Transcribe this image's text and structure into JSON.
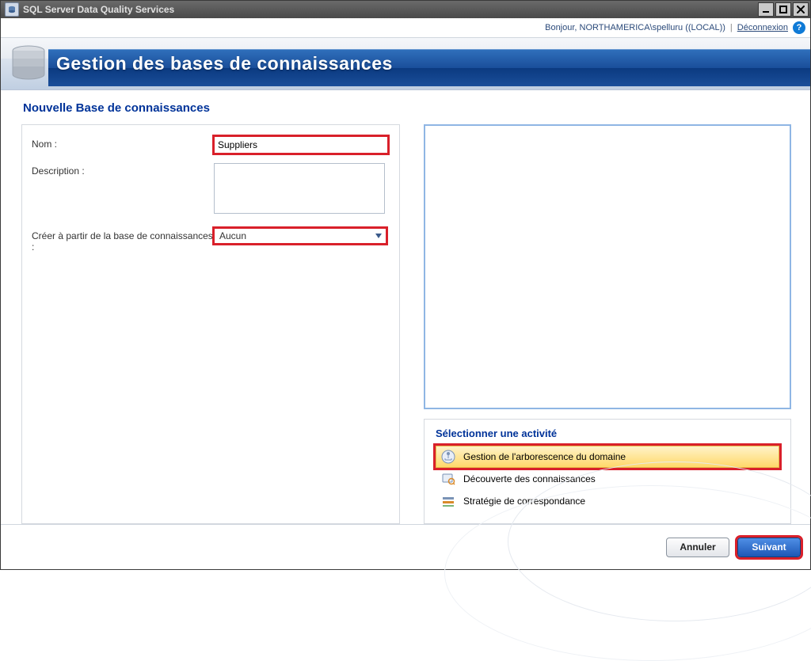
{
  "window": {
    "title": "SQL Server Data Quality Services"
  },
  "greetbar": {
    "greeting": "Bonjour, NORTHAMERICA\\spelluru ((LOCAL))",
    "separator": "|",
    "logout": "Déconnexion",
    "help_glyph": "?"
  },
  "banner": {
    "title": "Gestion des bases de connaissances"
  },
  "section": {
    "title": "Nouvelle Base de connaissances"
  },
  "form": {
    "name_label": "Nom :",
    "name_value": "Suppliers",
    "desc_label": "Description :",
    "desc_value": "",
    "createfrom_label": "Créer à partir de la base de connaissances :",
    "createfrom_value": "Aucun"
  },
  "activity": {
    "title": "Sélectionner une activité",
    "items": [
      {
        "label": "Gestion de l'arborescence du domaine",
        "selected": true
      },
      {
        "label": "Découverte des connaissances",
        "selected": false
      },
      {
        "label": "Stratégie de correspondance",
        "selected": false
      }
    ]
  },
  "footer": {
    "cancel": "Annuler",
    "next": "Suivant"
  },
  "colors": {
    "accent": "#003399",
    "highlight": "#d9202a"
  }
}
